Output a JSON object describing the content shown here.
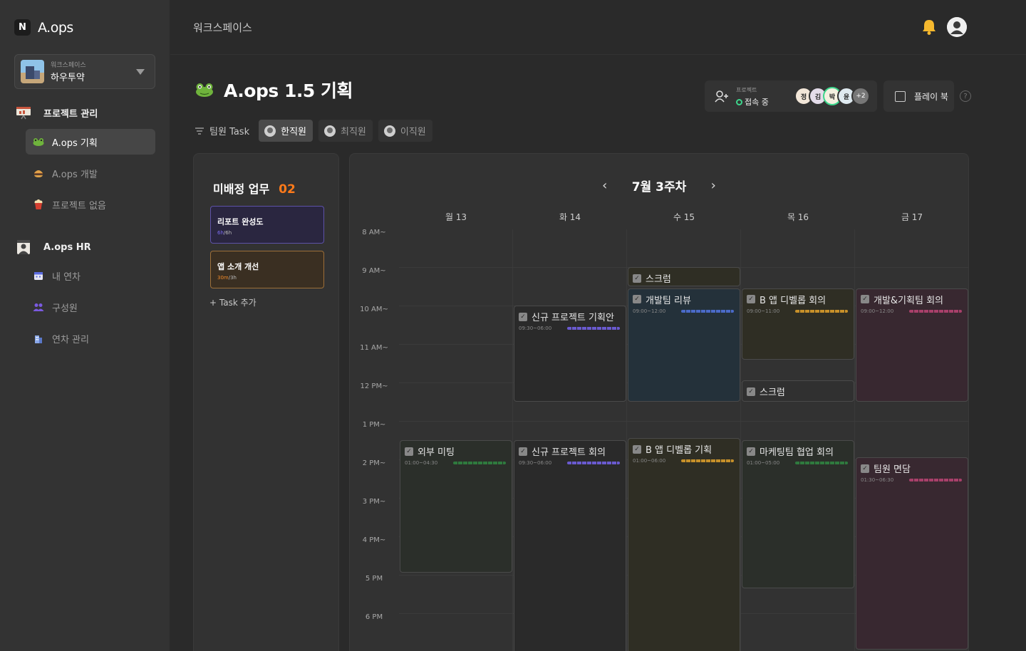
{
  "app": {
    "name": "A.ops",
    "logo_glyph": "N"
  },
  "workspace": {
    "sub_label": "워크스페이스",
    "name": "하우투약"
  },
  "sidebar": {
    "sections": [
      {
        "label": "프로젝트 관리",
        "items": [
          {
            "label": "A.ops 기획",
            "active": true
          },
          {
            "label": "A.ops 개발",
            "active": false
          },
          {
            "label": "프로젝트 없음",
            "active": false
          }
        ]
      },
      {
        "label": "A.ops HR",
        "items": [
          {
            "label": "내 연차",
            "active": false
          },
          {
            "label": "구성원",
            "active": false
          },
          {
            "label": "연차 관리",
            "active": false
          }
        ]
      }
    ]
  },
  "header": {
    "breadcrumb": "워크스페이스"
  },
  "project": {
    "title": "A.ops 1.5 기획",
    "presence": {
      "small_label": "프로젝트",
      "status": "접속 중",
      "avatars": [
        "정",
        "김",
        "박",
        "윤"
      ],
      "more": "+2"
    },
    "playbook_label": "플레이 북",
    "help": "?"
  },
  "filter": {
    "label": "팀원 Task",
    "members": [
      {
        "name": "한직원",
        "active": true
      },
      {
        "name": "최직원",
        "active": false
      },
      {
        "name": "이직원",
        "active": false
      }
    ]
  },
  "unassigned": {
    "title": "미배정 업무",
    "count": "02",
    "tasks": [
      {
        "name": "리포트 완성도",
        "time_done": "6h",
        "time_total": "/6h",
        "color": "purple"
      },
      {
        "name": "앱 소개 개선",
        "time_done": "30m",
        "time_total": "/3h",
        "color": "orange"
      }
    ],
    "add_label": "+  Task 추가"
  },
  "calendar": {
    "week_label": "7월 3주차",
    "prev": "‹",
    "next": "›",
    "days": [
      "월 13",
      "화 14",
      "수  15",
      "목 16",
      "금 17"
    ],
    "times": [
      "8 AM~",
      "9 AM~",
      "10 AM~",
      "11 AM~",
      "12 PM~",
      "1 PM~",
      "2 PM~",
      "3 PM~",
      "4 PM~",
      "5 PM",
      "6 PM"
    ],
    "events": [
      {
        "title": "외부 미팅",
        "time": "01:00~04:30",
        "day": 0,
        "start": 13.0,
        "end": 16.45,
        "bg": "ev-green",
        "bar": "#2f7a3e"
      },
      {
        "title": "신규 프로젝트 기획안",
        "time": "09:30~06:00",
        "day": 1,
        "start": 9.5,
        "end": 12.0,
        "bg": "ev-dark",
        "bar": "#6a5ad0"
      },
      {
        "title": "신규 프로젝트 회의",
        "time": "09:30~06:00",
        "day": 1,
        "start": 13.0,
        "end": 19.0,
        "bg": "ev-dark",
        "bar": "#6a5ad0"
      },
      {
        "title": "스크럼",
        "time": "",
        "day": 2,
        "start": 8.5,
        "end": 9.0,
        "bg": "ev-olive",
        "bar": ""
      },
      {
        "title": "개발팀 리뷰",
        "time": "09:00~12:00",
        "day": 2,
        "start": 9.05,
        "end": 12.0,
        "bg": "ev-blue",
        "bar": "#4a6ac8"
      },
      {
        "title": "B 앱 디벨롭 기획",
        "time": "01:00~06:00",
        "day": 2,
        "start": 12.95,
        "end": 19.0,
        "bg": "ev-olive",
        "bar": "#c7902a"
      },
      {
        "title": "B 앱 디벨롭 회의",
        "time": "09:00~11:00",
        "day": 3,
        "start": 9.05,
        "end": 10.9,
        "bg": "ev-olive",
        "bar": "#c7902a"
      },
      {
        "title": "스크럼",
        "time": "",
        "day": 3,
        "start": 11.45,
        "end": 12.0,
        "bg": "ev-grey",
        "bar": ""
      },
      {
        "title": "마케팅팀 협업 회의",
        "time": "01:00~05:00",
        "day": 3,
        "start": 13.0,
        "end": 16.85,
        "bg": "ev-green",
        "bar": "#2f7a3e"
      },
      {
        "title": "개발&기획팀 회의",
        "time": "09:00~12:00",
        "day": 4,
        "start": 9.05,
        "end": 12.0,
        "bg": "ev-pink",
        "bar": "#a8406a"
      },
      {
        "title": "팀원 면담",
        "time": "01:30~06:30",
        "day": 4,
        "start": 13.45,
        "end": 18.45,
        "bg": "ev-pink",
        "bar": "#a8406a"
      }
    ]
  }
}
